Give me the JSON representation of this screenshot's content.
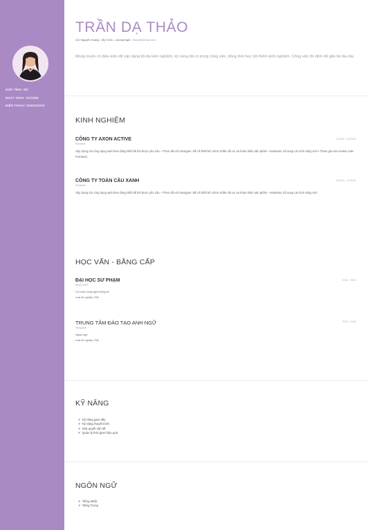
{
  "sidebar": {
    "info": [
      {
        "label": "GIỚI TÍNH:",
        "value": "NỮ"
      },
      {
        "label": "NGÀY SINH:",
        "value": "1/1/1995"
      },
      {
        "label": "ĐIỆN THOẠI:",
        "value": "0362162019"
      }
    ],
    "background_color": "#a98ac4"
  },
  "header": {
    "name": "TRẦN DẠ THẢO",
    "address": "242 Nguyễn Hoàng - Mỹ Chữu - Quảng Ngãi",
    "email": "thao@hotmail.com",
    "objective": "Mong muốn có điều kiện để vận dụng tối đa kinh nghiệm, kỹ năng đã có trong công việc, đồng thời học hỏi thêm kinh nghiệm. Công việc ổn định để gắn bó lâu dài."
  },
  "experience": {
    "title": "KINH NGHIỆM",
    "items": [
      {
        "company": "CÔNG TY AXON ACTIVE",
        "role": "Frontend",
        "date": "1/2020 - 12/2020",
        "description": "Xây dựng các ứng dụng web theo đúng thiết kế khi được yêu cầu. • Theo dõi với Designer. Đề về thiết kế UI/UX nhằm tối ưu và hoàn thiện sản phẩm. • Maintain, bổ sung các tính năng mới • Tham gia vào review code Frontend."
      },
      {
        "company": "CÔNG TY TOÀN CẦU XANH",
        "role": "Frontend",
        "date": "6/2019 - 11/2020",
        "description": "Xây dựng các ứng dụng web theo đúng thiết kế khi được yêu cầu. • Theo dõi với Designer. Đề về thiết kế UI/UX nhằm tối ưu và hoàn thiện sản phẩm. • Maintain, bổ sung các tính năng mới"
      }
    ]
  },
  "education": {
    "title": "HỌC VẤN - BẰNG CẤP",
    "items": [
      {
        "school": "ĐẠI HỌC SƯ PHẠM",
        "field": "Khoa CNTT",
        "date": "2014 - 2019",
        "lines": [
          "Cử nhân công nghệ thông tin",
          "Loại tốt nghiệp: Giỏi"
        ]
      },
      {
        "school": "TRUNG TÂM ĐÀO TẠO ANH NGỮ",
        "field": "Tiếng Anh",
        "date": "2015 - 2018",
        "lines": [
          "Ngoại ngữ",
          "Loại tốt nghiệp: Giỏi"
        ]
      }
    ]
  },
  "skills": {
    "title": "KỸ NĂNG",
    "items": [
      "Kỹ năng giao tiếp",
      "Kỹ năng thuyết trình",
      "Giải quyết vấn đề",
      "Quản lý thời gian hiệu quả"
    ]
  },
  "languages": {
    "title": "NGÔN NGỮ",
    "items": [
      "Tiếng Nhật",
      "Tiếng Trung"
    ]
  },
  "icons": {
    "list_bullet": "checkmark-icon"
  }
}
